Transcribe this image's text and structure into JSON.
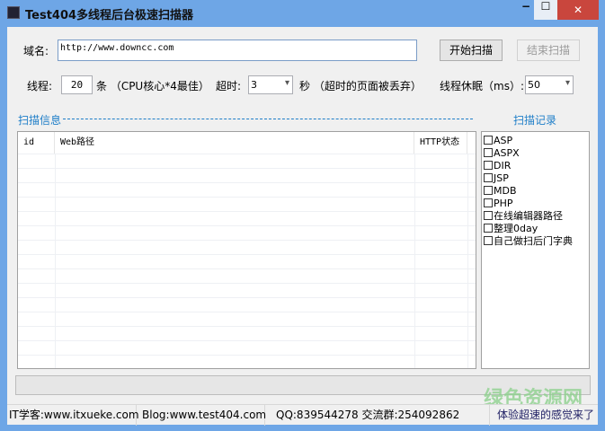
{
  "window": {
    "title": "Test404多线程后台极速扫描器",
    "min": "−",
    "max": "☐",
    "close": "✕"
  },
  "domain": {
    "label": "域名:",
    "value": "http://www.downcc.com"
  },
  "buttons": {
    "start": "开始扫描",
    "stop": "结束扫描"
  },
  "threads": {
    "label": "线程:",
    "value": "20",
    "suffix": "条 （CPU核心*4最佳）"
  },
  "timeout": {
    "label": "超时:",
    "value": "3",
    "suffix": "秒 （超时的页面被丢弃）"
  },
  "sleep": {
    "label": "线程休眠（ms）:",
    "value": "50"
  },
  "scan_info": {
    "title": "扫描信息",
    "columns": [
      "id",
      "Web路径",
      "HTTP状态"
    ]
  },
  "scan_record": {
    "title": "扫描记录",
    "items": [
      "ASP",
      "ASPX",
      "DIR",
      "JSP",
      "MDB",
      "PHP",
      "在线编辑器路径",
      "整理0day",
      "自己做扫后门字典"
    ]
  },
  "status": {
    "it": "IT学客:www.itxueke.com",
    "blog": "Blog:www.test404.com",
    "qq": "QQ:839544278  交流群:254092862",
    "slogan": "体验超速的感觉来了"
  },
  "watermark": "绿色资源网"
}
